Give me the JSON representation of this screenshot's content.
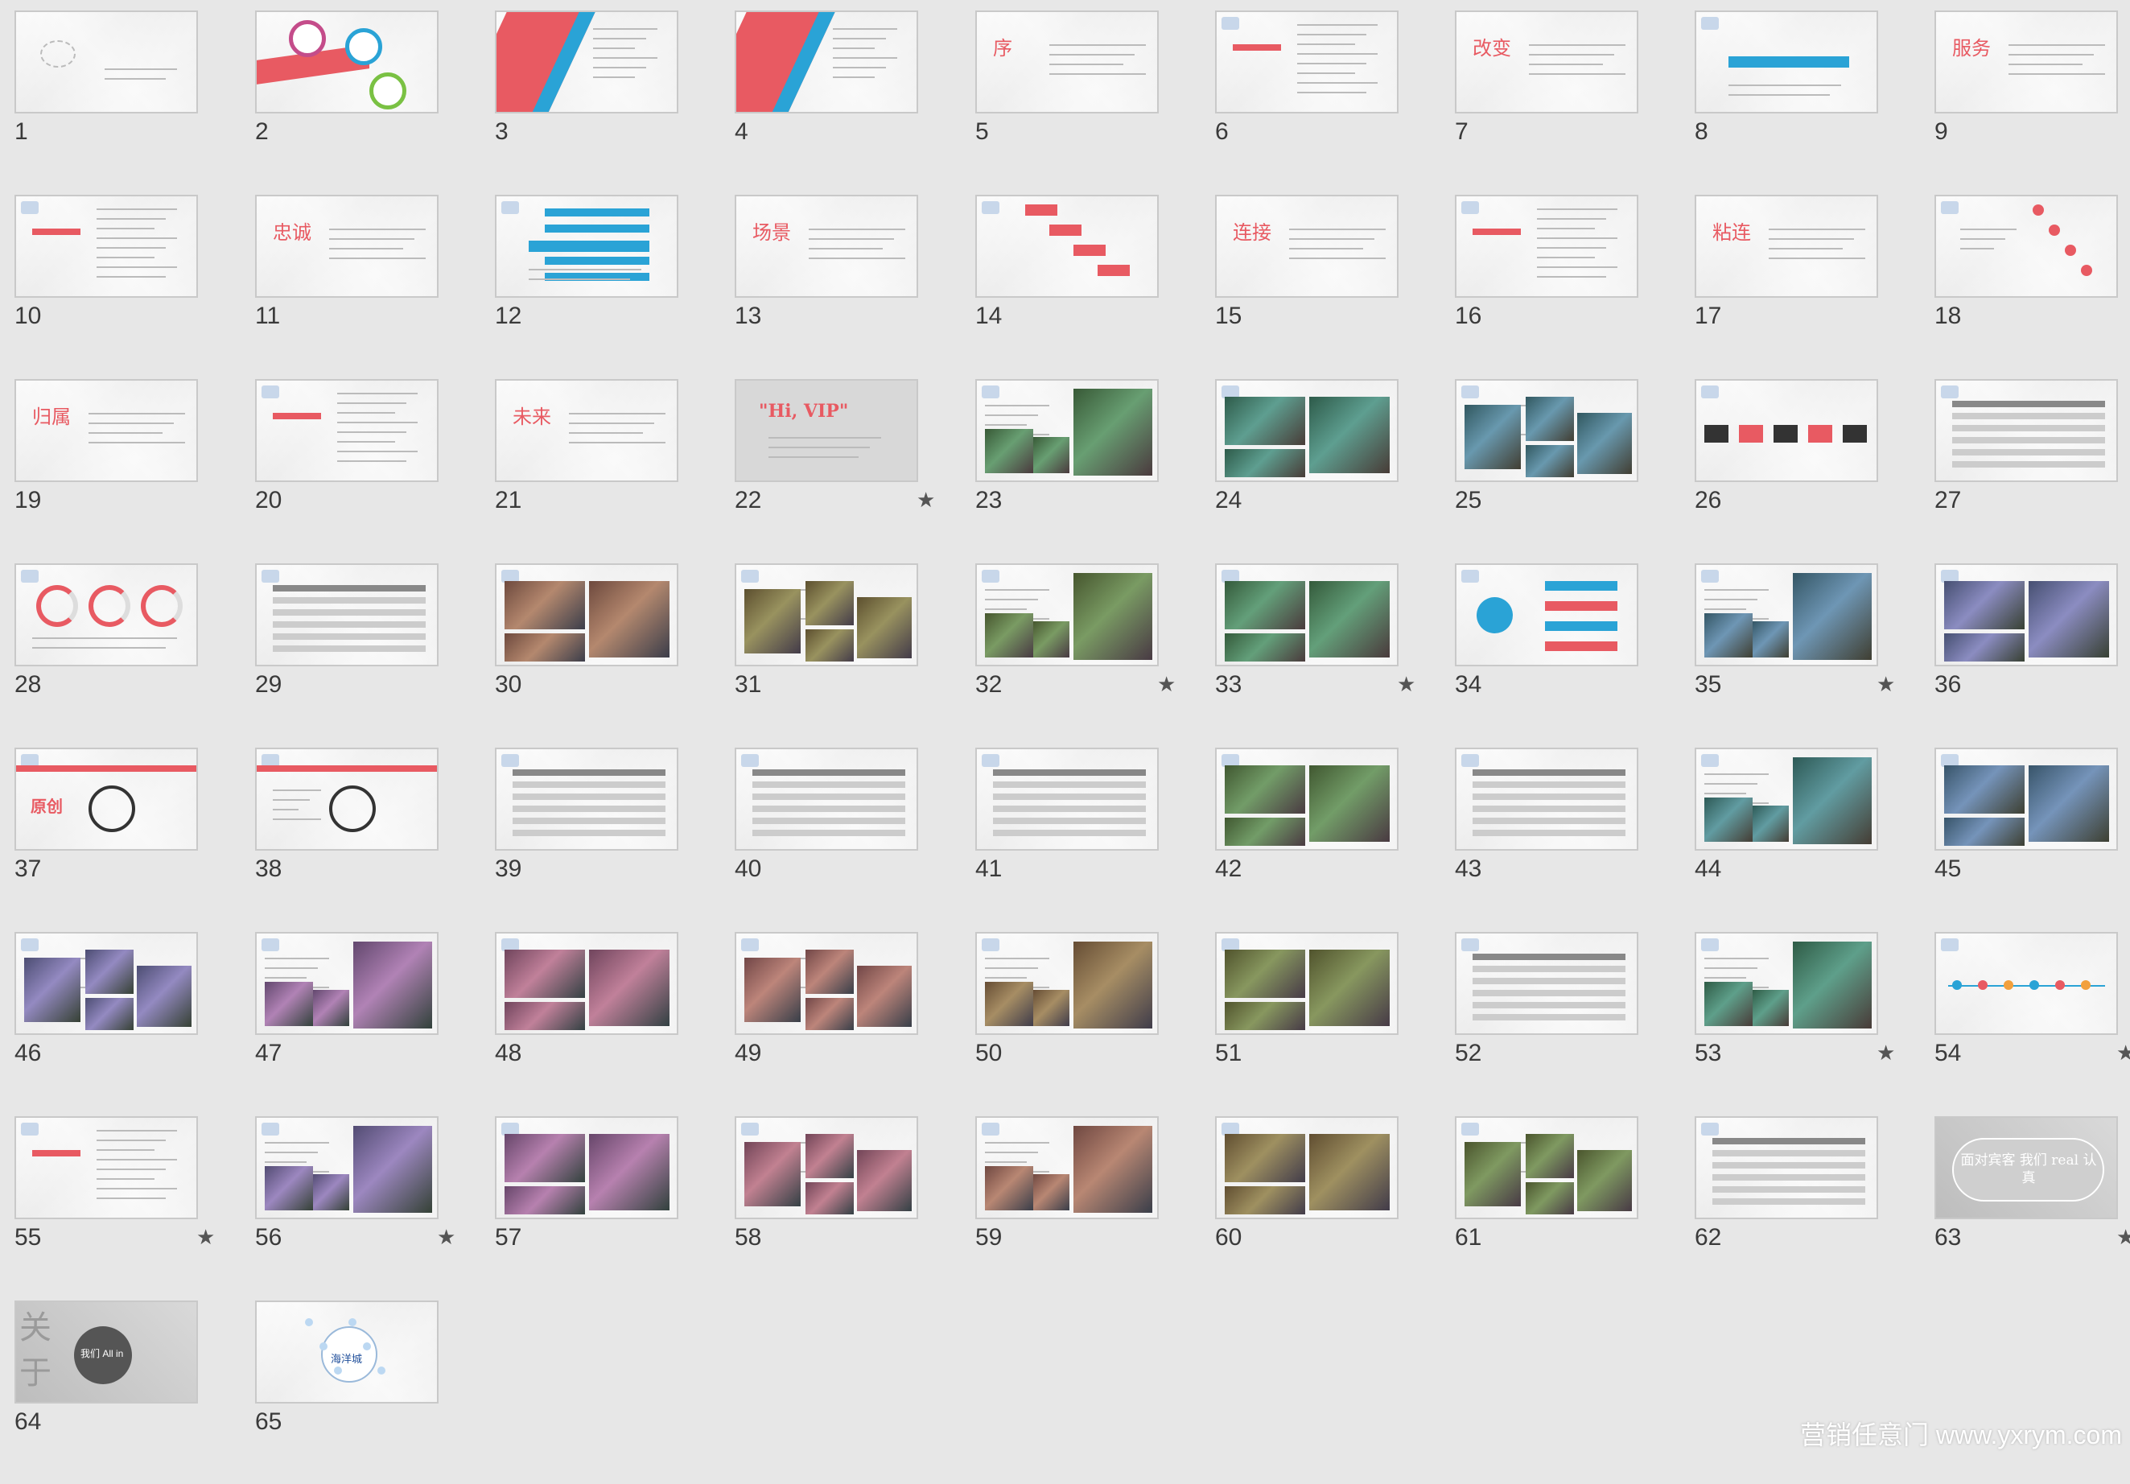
{
  "slides": [
    {
      "n": "1",
      "star": false,
      "style": "title"
    },
    {
      "n": "2",
      "star": false,
      "style": "circles"
    },
    {
      "n": "3",
      "star": false,
      "style": "redwedge"
    },
    {
      "n": "4",
      "star": false,
      "style": "redwedge"
    },
    {
      "n": "5",
      "star": false,
      "style": "textbig",
      "big": "序"
    },
    {
      "n": "6",
      "star": false,
      "style": "list"
    },
    {
      "n": "7",
      "star": false,
      "style": "textbig",
      "big": "改变"
    },
    {
      "n": "8",
      "star": false,
      "style": "bluebar"
    },
    {
      "n": "9",
      "star": false,
      "style": "textbig",
      "big": "服务"
    },
    {
      "n": "10",
      "star": false,
      "style": "list"
    },
    {
      "n": "11",
      "star": false,
      "style": "textbig",
      "big": "忠诚"
    },
    {
      "n": "12",
      "star": false,
      "style": "bluetable"
    },
    {
      "n": "13",
      "star": false,
      "style": "textbig",
      "big": "场景"
    },
    {
      "n": "14",
      "star": false,
      "style": "steps"
    },
    {
      "n": "15",
      "star": false,
      "style": "textbig",
      "big": "连接"
    },
    {
      "n": "16",
      "star": false,
      "style": "list"
    },
    {
      "n": "17",
      "star": false,
      "style": "textbig",
      "big": "粘连"
    },
    {
      "n": "18",
      "star": false,
      "style": "pins"
    },
    {
      "n": "19",
      "star": false,
      "style": "textbig",
      "big": "归属"
    },
    {
      "n": "20",
      "star": false,
      "style": "list"
    },
    {
      "n": "21",
      "star": false,
      "style": "textbig",
      "big": "未来"
    },
    {
      "n": "22",
      "star": true,
      "style": "vip",
      "big": "\"Hi, VIP\""
    },
    {
      "n": "23",
      "star": false,
      "style": "photos"
    },
    {
      "n": "24",
      "star": false,
      "style": "photos"
    },
    {
      "n": "25",
      "star": false,
      "style": "photos"
    },
    {
      "n": "26",
      "star": false,
      "style": "numbers"
    },
    {
      "n": "27",
      "star": false,
      "style": "table"
    },
    {
      "n": "28",
      "star": false,
      "style": "donuts"
    },
    {
      "n": "29",
      "star": false,
      "style": "table"
    },
    {
      "n": "30",
      "star": false,
      "style": "photos"
    },
    {
      "n": "31",
      "star": false,
      "style": "photos"
    },
    {
      "n": "32",
      "star": true,
      "style": "photos"
    },
    {
      "n": "33",
      "star": true,
      "style": "photos"
    },
    {
      "n": "34",
      "star": false,
      "style": "hub"
    },
    {
      "n": "35",
      "star": true,
      "style": "photos"
    },
    {
      "n": "36",
      "star": false,
      "style": "photos"
    },
    {
      "n": "37",
      "star": false,
      "style": "redband",
      "big": "原创"
    },
    {
      "n": "38",
      "star": false,
      "style": "redband"
    },
    {
      "n": "39",
      "star": false,
      "style": "table"
    },
    {
      "n": "40",
      "star": false,
      "style": "table"
    },
    {
      "n": "41",
      "star": false,
      "style": "table"
    },
    {
      "n": "42",
      "star": false,
      "style": "photos"
    },
    {
      "n": "43",
      "star": false,
      "style": "table"
    },
    {
      "n": "44",
      "star": false,
      "style": "photos"
    },
    {
      "n": "45",
      "star": false,
      "style": "photos"
    },
    {
      "n": "46",
      "star": false,
      "style": "photos"
    },
    {
      "n": "47",
      "star": false,
      "style": "photos"
    },
    {
      "n": "48",
      "star": false,
      "style": "photos"
    },
    {
      "n": "49",
      "star": false,
      "style": "photos"
    },
    {
      "n": "50",
      "star": false,
      "style": "photos"
    },
    {
      "n": "51",
      "star": false,
      "style": "photos"
    },
    {
      "n": "52",
      "star": false,
      "style": "table"
    },
    {
      "n": "53",
      "star": true,
      "style": "photos"
    },
    {
      "n": "54",
      "star": true,
      "style": "timeline"
    },
    {
      "n": "55",
      "star": true,
      "style": "list"
    },
    {
      "n": "56",
      "star": true,
      "style": "photos"
    },
    {
      "n": "57",
      "star": false,
      "style": "photos"
    },
    {
      "n": "58",
      "star": false,
      "style": "photos"
    },
    {
      "n": "59",
      "star": false,
      "style": "photos"
    },
    {
      "n": "60",
      "star": false,
      "style": "photos"
    },
    {
      "n": "61",
      "star": false,
      "style": "photos"
    },
    {
      "n": "62",
      "star": false,
      "style": "table"
    },
    {
      "n": "63",
      "star": true,
      "style": "quote",
      "big": "面对宾客 我们 real 认真"
    },
    {
      "n": "64",
      "star": false,
      "style": "about",
      "big": "关于 服务",
      "sub": "我们 All in"
    },
    {
      "n": "65",
      "star": false,
      "style": "logo",
      "big": "海洋城"
    }
  ],
  "star_glyph": "★",
  "watermark": "营销任意门 www.yxrym.com",
  "colors": {
    "accent_red": "#e85a62",
    "accent_blue": "#2aa3d6"
  }
}
